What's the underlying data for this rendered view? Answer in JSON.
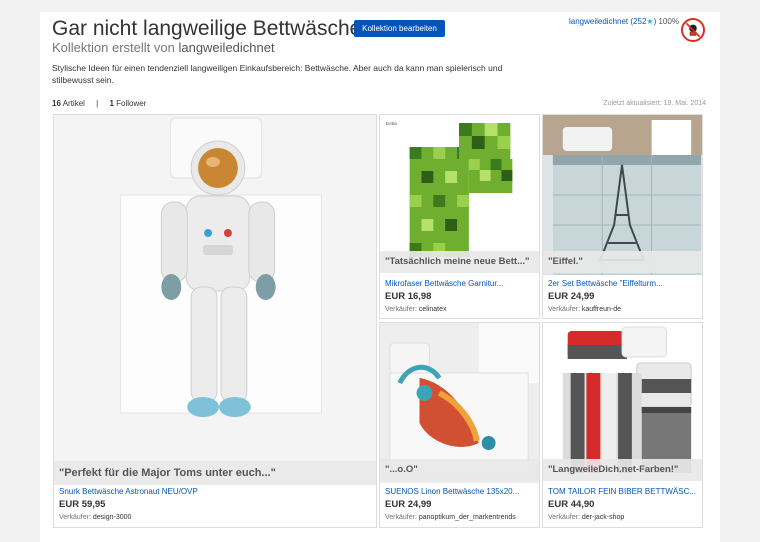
{
  "collection": {
    "title": "Gar nicht langweilige Bettwäsche",
    "edit_button": "Kollektion bearbeiten",
    "subtitle_prefix": "Kollektion erstellt von",
    "author": "langweiledichnet",
    "owner_name": "langweiledichnet",
    "owner_feedback": "(252",
    "owner_star": "★",
    "owner_feedback_close": ")",
    "owner_percent": "100%",
    "description": "Stylische Ideen für einen tendenziell langweiligen Einkaufsbereich: Bettwäsche. Aber auch da kann man spielerisch und stilbewusst sein.",
    "article_count": "16",
    "article_label": "Artikel",
    "separator": "|",
    "follower_count": "1",
    "follower_label": "Follower",
    "updated": "Zuletzt aktualisiert: 19. Mai. 2014"
  },
  "seller_label": "Verkäufer:",
  "items": [
    {
      "quote": "\"Perfekt für die Major Toms unter euch...\"",
      "title": "Snurk Bettwäsche Astronaut NEU/OVP",
      "price": "EUR 59,95",
      "seller": "design-3000",
      "image": "astronaut-bedding"
    },
    {
      "quote": "\"Tatsächlich meine neue Bett...\"",
      "title": "Mikrofaser Bettwäsche Garnitur...",
      "price": "EUR 16,98",
      "seller": "celinatex",
      "image": "green-pixel-bedding",
      "brand_tag": "Estia"
    },
    {
      "quote": "\"Eiffel.\"",
      "title": "2er Set Bettwäsche \"Eiffelturm...",
      "price": "EUR 24,99",
      "seller": "kauffreun-de",
      "image": "eiffel-tower-bedding"
    },
    {
      "quote": "\"...o.O\"",
      "title": "SUENOS Linon Bettwäsche 135x20...",
      "price": "EUR 24,99",
      "seller": "panoptikum_der_markentrends",
      "image": "koi-fish-bedding"
    },
    {
      "quote": "\"LangweileDich.net-Farben!\"",
      "title": "TOM TAILOR FEIN BIBER BETTWÄSC...",
      "price": "EUR 44,90",
      "seller": "der-jack-shop",
      "image": "striped-red-grey-bedding"
    }
  ],
  "colors": {
    "link": "#0654ba",
    "button": "#0654ba",
    "green_dark": "#3d7a1e",
    "green_light": "#8cc63f",
    "stripe_red": "#d42a2a",
    "stripe_grey": "#555555"
  }
}
